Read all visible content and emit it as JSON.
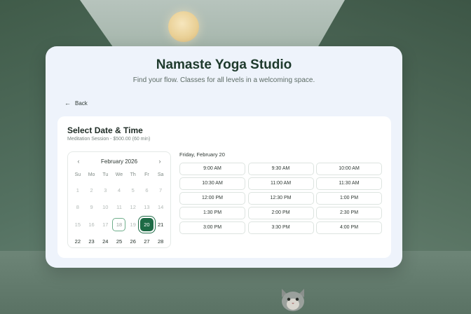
{
  "studio": {
    "title": "Namaste Yoga Studio",
    "subtitle": "Find your flow. Classes for all levels in a welcoming space."
  },
  "nav": {
    "back_label": "Back",
    "back_icon": "arrow-left-icon"
  },
  "booking": {
    "title": "Select Date & Time",
    "session": "Meditation Session - $500.00 (60 min)"
  },
  "calendar": {
    "month_label": "February 2026",
    "prev_icon": "chevron-left-icon",
    "next_icon": "chevron-right-icon",
    "weekdays": [
      "Su",
      "Mo",
      "Tu",
      "We",
      "Th",
      "Fr",
      "Sa"
    ],
    "days": [
      {
        "n": "1",
        "state": "disabled"
      },
      {
        "n": "2",
        "state": "disabled"
      },
      {
        "n": "3",
        "state": "disabled"
      },
      {
        "n": "4",
        "state": "disabled"
      },
      {
        "n": "5",
        "state": "disabled"
      },
      {
        "n": "6",
        "state": "disabled"
      },
      {
        "n": "7",
        "state": "disabled"
      },
      {
        "n": "8",
        "state": "disabled"
      },
      {
        "n": "9",
        "state": "disabled"
      },
      {
        "n": "10",
        "state": "disabled"
      },
      {
        "n": "11",
        "state": "disabled"
      },
      {
        "n": "12",
        "state": "disabled"
      },
      {
        "n": "13",
        "state": "disabled"
      },
      {
        "n": "14",
        "state": "disabled"
      },
      {
        "n": "15",
        "state": "disabled"
      },
      {
        "n": "16",
        "state": "disabled"
      },
      {
        "n": "17",
        "state": "disabled"
      },
      {
        "n": "18",
        "state": "today"
      },
      {
        "n": "19",
        "state": "disabled"
      },
      {
        "n": "20",
        "state": "selected"
      },
      {
        "n": "21",
        "state": "enabled"
      },
      {
        "n": "22",
        "state": "enabled"
      },
      {
        "n": "23",
        "state": "enabled"
      },
      {
        "n": "24",
        "state": "enabled"
      },
      {
        "n": "25",
        "state": "enabled"
      },
      {
        "n": "26",
        "state": "enabled"
      },
      {
        "n": "27",
        "state": "enabled"
      },
      {
        "n": "28",
        "state": "enabled"
      }
    ]
  },
  "times": {
    "date_label": "Friday, February 20",
    "slots": [
      "9:00 AM",
      "9:30 AM",
      "10:00 AM",
      "10:30 AM",
      "11:00 AM",
      "11:30 AM",
      "12:00 PM",
      "12:30 PM",
      "1:00 PM",
      "1:30 PM",
      "2:00 PM",
      "2:30 PM",
      "3:00 PM",
      "3:30 PM",
      "4:00 PM"
    ]
  },
  "colors": {
    "accent": "#1d6a45",
    "card_bg": "#eef3fb",
    "title_text": "#1e3a2c"
  }
}
